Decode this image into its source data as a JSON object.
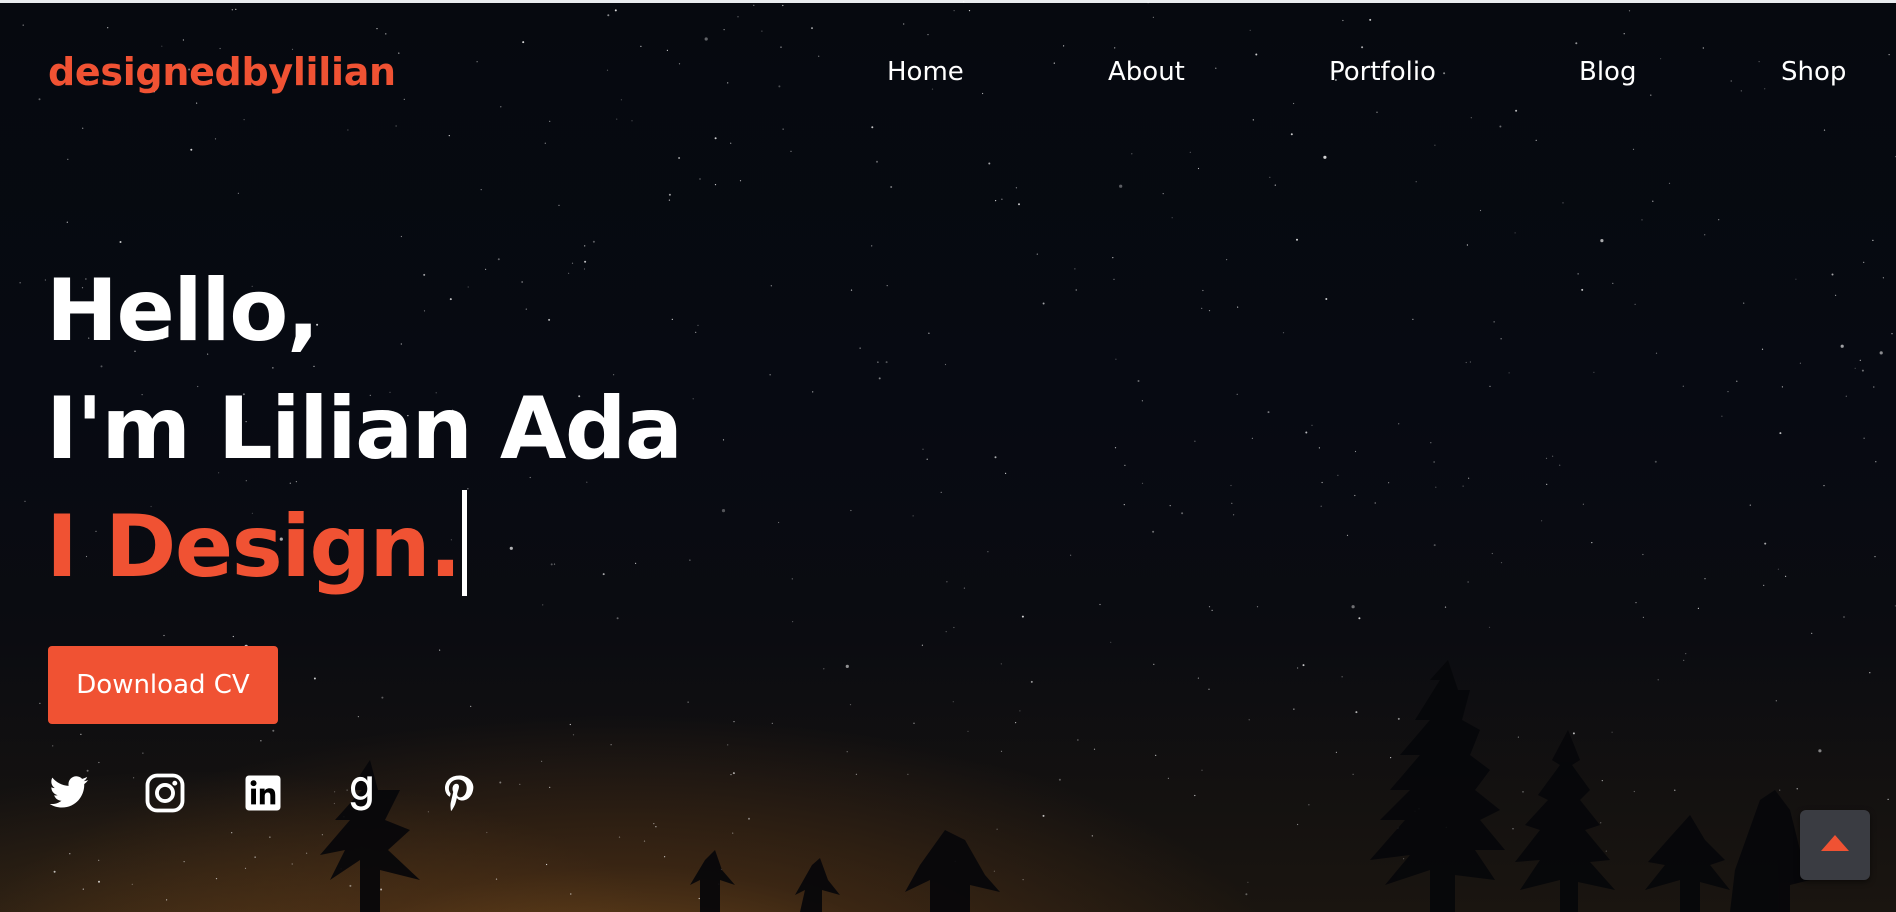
{
  "brand": {
    "logo_text": "designedbylilian",
    "accent_color": "#f05233"
  },
  "nav": {
    "items": [
      {
        "label": "Home"
      },
      {
        "label": "About"
      },
      {
        "label": "Portfolio"
      },
      {
        "label": "Blog"
      },
      {
        "label": "Shop"
      }
    ]
  },
  "hero": {
    "line1": "Hello,",
    "line2": "I'm Lilian Ada",
    "line3": "I Design.",
    "cta_label": "Download CV"
  },
  "social": [
    "twitter-icon",
    "instagram-icon",
    "linkedin-icon",
    "goodreads-icon",
    "pinterest-icon"
  ],
  "scroll_top": {
    "icon": "caret-up-icon"
  }
}
